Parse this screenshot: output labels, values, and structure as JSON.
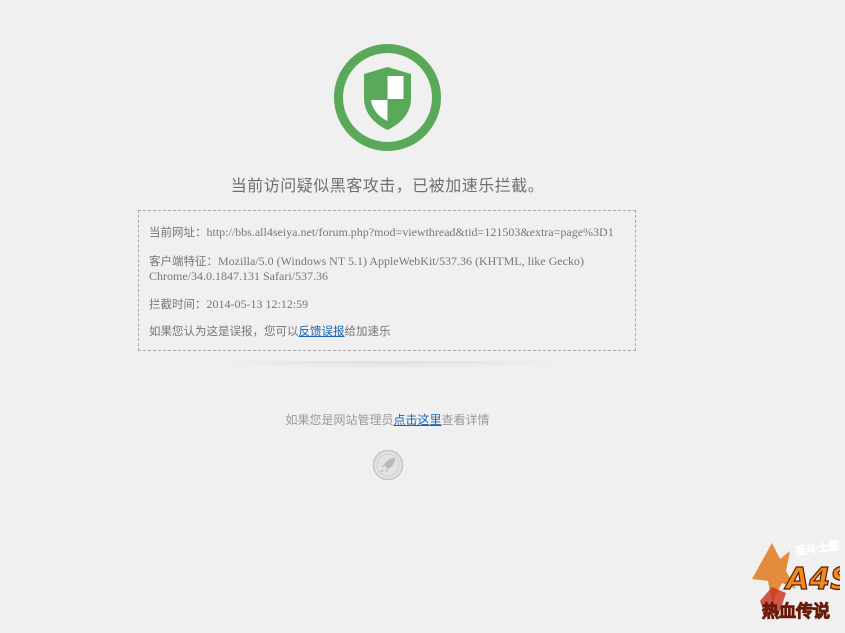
{
  "headline": "当前访问疑似黑客攻击，已被加速乐拦截。",
  "details": {
    "url_label": "当前网址：",
    "url_value": "http://bbs.all4seiya.net/forum.php?mod=viewthread&tid=121503&extra=page%3D1",
    "ua_label": "客户端特征：",
    "ua_value": "Mozilla/5.0 (Windows NT 5.1) AppleWebKit/537.36 (KHTML, like Gecko) Chrome/34.0.1847.131 Safari/537.36",
    "time_label": "拦截时间：",
    "time_value": "2014-05-13 12:12:59",
    "report_prefix": "如果您认为这是误报，您可以",
    "report_link": "反馈误报",
    "report_suffix": "给加速乐"
  },
  "admin": {
    "prefix": "如果您是网站管理员",
    "link": "点击这里",
    "suffix": "查看详情"
  },
  "logo": {
    "top_text": "圣斗士星矢",
    "main_text": "A4S",
    "bottom_text": "热血传说"
  },
  "colors": {
    "shield_green": "#5aa85a",
    "link_blue": "#1e64b4",
    "background": "#eff0ef"
  }
}
